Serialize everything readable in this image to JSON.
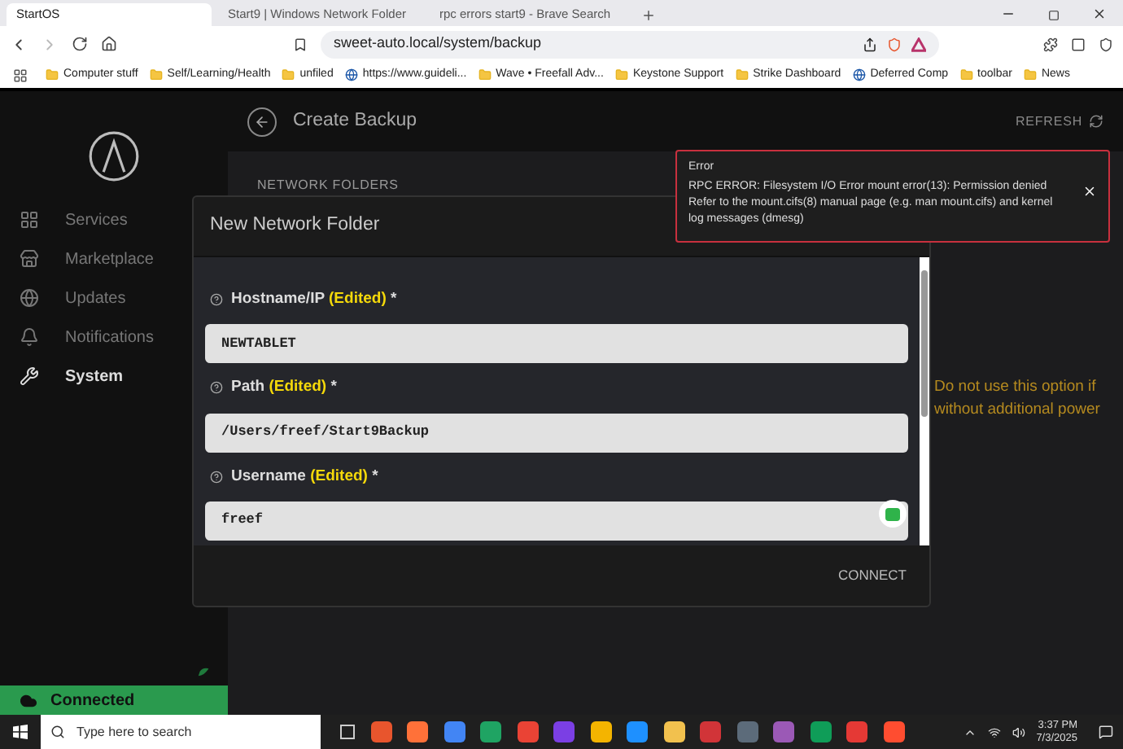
{
  "browser": {
    "tabs": [
      {
        "title": "StartOS",
        "selected": true
      },
      {
        "title": "Start9 | Windows Network Folder",
        "selected": false
      },
      {
        "title": "rpc errors start9 - Brave Search",
        "selected": false
      }
    ],
    "url": "sweet-auto.local/system/backup",
    "bookmarks": [
      "Computer stuff",
      "Self/Learning/Health",
      "unfiled",
      "https://www.guideli...",
      "Wave • Freefall Adv...",
      "Keystone Support",
      "Strike Dashboard",
      "Deferred Comp",
      "toolbar",
      "News"
    ]
  },
  "sidebar": {
    "items": [
      {
        "label": "Services",
        "selected": false
      },
      {
        "label": "Marketplace",
        "selected": false
      },
      {
        "label": "Updates",
        "selected": false
      },
      {
        "label": "Notifications",
        "selected": false
      },
      {
        "label": "System",
        "selected": true
      }
    ],
    "status": "Connected"
  },
  "page": {
    "title": "Create Backup",
    "refresh": "REFRESH",
    "section": "NETWORK FOLDERS",
    "warning": [
      "Do not use this option if",
      "without additional power"
    ]
  },
  "toast": {
    "title": "Error",
    "message": "RPC ERROR: Filesystem I/O Error mount error(13): Permission denied Refer to the mount.cifs(8) manual page (e.g. man mount.cifs) and kernel log messages (dmesg)"
  },
  "modal": {
    "title": "New Network Folder",
    "fields": [
      {
        "label": "Hostname/IP",
        "tag": "(Edited)",
        "required": "*",
        "value": "NEWTABLET"
      },
      {
        "label": "Path",
        "tag": "(Edited)",
        "required": "*",
        "value": "/Users/freef/Start9Backup"
      },
      {
        "label": "Username",
        "tag": "(Edited)",
        "required": "*",
        "value": "freef"
      }
    ],
    "button": "CONNECT"
  },
  "taskbar": {
    "search": {
      "placeholder": "Type here to search"
    },
    "time": "3:37 PM",
    "date": "7/3/2025"
  }
}
